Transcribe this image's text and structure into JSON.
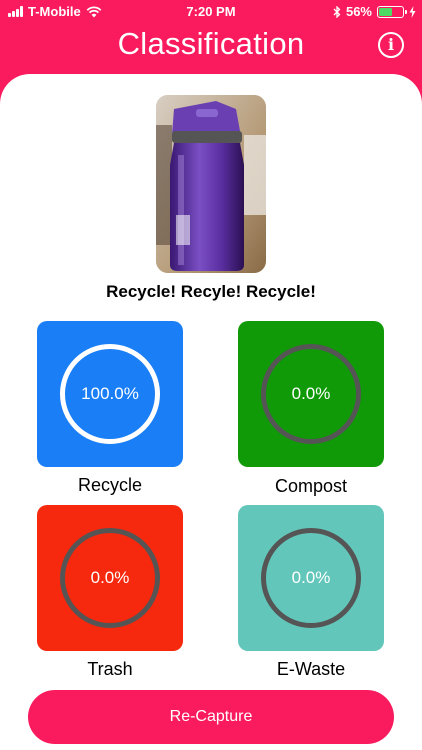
{
  "status_bar": {
    "carrier": "T-Mobile",
    "time": "7:20 PM",
    "battery_percent": "56%",
    "battery_level": 0.56
  },
  "header": {
    "title": "Classification",
    "info_icon": "i"
  },
  "result": {
    "headline": "Recycle! Recyle! Recycle!"
  },
  "categories": [
    {
      "label": "Recycle",
      "value": "100.0%",
      "color": "#1A7EF6"
    },
    {
      "label": "Compost",
      "value": "0.0%",
      "color": "#109A08"
    },
    {
      "label": "Trash",
      "value": "0.0%",
      "color": "#F6280E"
    },
    {
      "label": "E-Waste",
      "value": "0.0%",
      "color": "#62C6BA"
    }
  ],
  "actions": {
    "recapture_label": "Re-Capture"
  },
  "colors": {
    "brand": "#FA1A5E"
  }
}
